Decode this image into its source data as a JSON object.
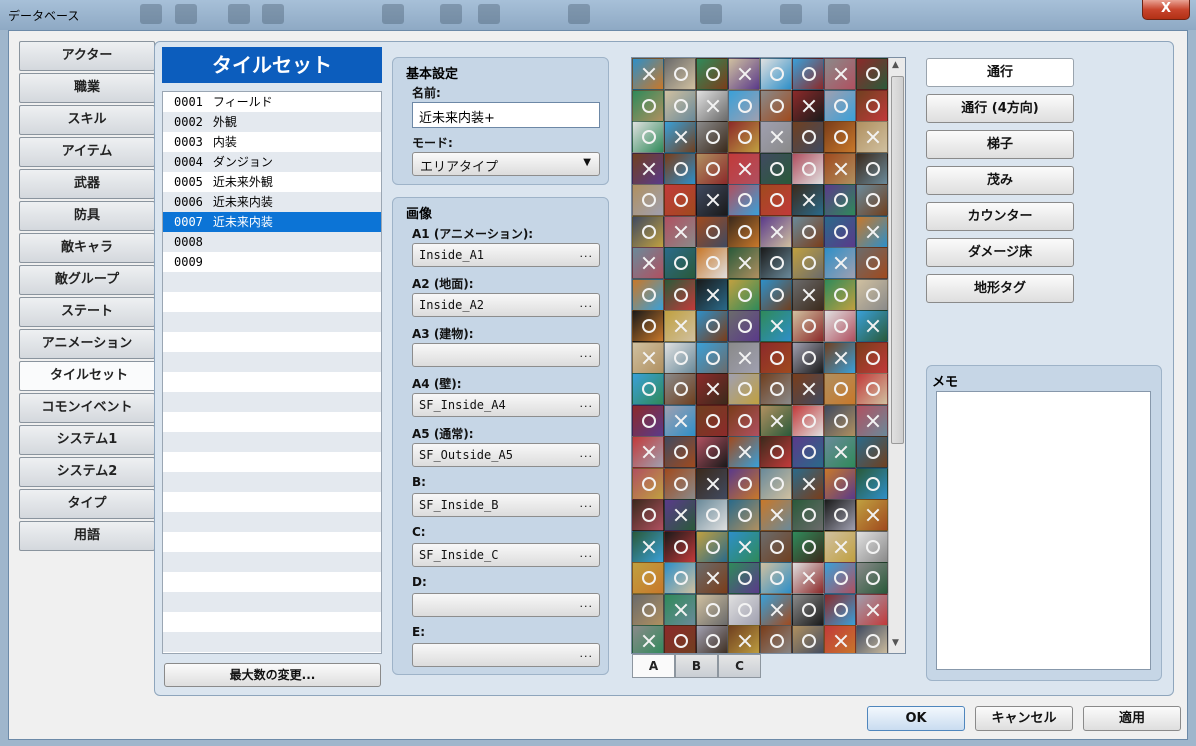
{
  "window": {
    "title": "データベース",
    "close_label": "X"
  },
  "nav": {
    "items": [
      {
        "label": "アクター"
      },
      {
        "label": "職業"
      },
      {
        "label": "スキル"
      },
      {
        "label": "アイテム"
      },
      {
        "label": "武器"
      },
      {
        "label": "防具"
      },
      {
        "label": "敵キャラ"
      },
      {
        "label": "敵グループ"
      },
      {
        "label": "ステート"
      },
      {
        "label": "アニメーション"
      },
      {
        "label": "タイルセット"
      },
      {
        "label": "コモンイベント"
      },
      {
        "label": "システム1"
      },
      {
        "label": "システム2"
      },
      {
        "label": "タイプ"
      },
      {
        "label": "用語"
      }
    ],
    "active_index": 10
  },
  "tileset_list": {
    "header": "タイルセット",
    "rows": [
      {
        "id": "0001",
        "name": "フィールド"
      },
      {
        "id": "0002",
        "name": "外観"
      },
      {
        "id": "0003",
        "name": "内装"
      },
      {
        "id": "0004",
        "name": "ダンジョン"
      },
      {
        "id": "0005",
        "name": "近未来外観"
      },
      {
        "id": "0006",
        "name": "近未来内装"
      },
      {
        "id": "0007",
        "name": "近未来内装"
      },
      {
        "id": "0008",
        "name": ""
      },
      {
        "id": "0009",
        "name": ""
      }
    ],
    "selected_index": 6,
    "max_button_label": "最大数の変更..."
  },
  "basic_settings": {
    "title": "基本設定",
    "name_label": "名前:",
    "name_value": "近未来内装+",
    "mode_label": "モード:",
    "mode_value": "エリアタイプ"
  },
  "images": {
    "title": "画像",
    "slots": [
      {
        "label": "A1 (アニメーション):",
        "value": "Inside_A1"
      },
      {
        "label": "A2 (地面):",
        "value": "Inside_A2"
      },
      {
        "label": "A3 (建物):",
        "value": ""
      },
      {
        "label": "A4 (壁):",
        "value": "SF_Inside_A4"
      },
      {
        "label": "A5 (通常):",
        "value": "SF_Outside_A5"
      },
      {
        "label": "B:",
        "value": "SF_Inside_B"
      },
      {
        "label": "C:",
        "value": "SF_Inside_C"
      },
      {
        "label": "D:",
        "value": ""
      },
      {
        "label": "E:",
        "value": ""
      }
    ],
    "picker_button": "..."
  },
  "tile_tabs": [
    {
      "label": "A"
    },
    {
      "label": "B"
    },
    {
      "label": "C"
    }
  ],
  "tile_tabs_active_index": 0,
  "flag_buttons": [
    {
      "label": "通行"
    },
    {
      "label": "通行 (4方向)"
    },
    {
      "label": "梯子"
    },
    {
      "label": "茂み"
    },
    {
      "label": "カウンター"
    },
    {
      "label": "ダメージ床"
    },
    {
      "label": "地形タグ"
    }
  ],
  "memo": {
    "label": "メモ",
    "value": ""
  },
  "dialog_buttons": {
    "ok": "OK",
    "cancel": "キャンセル",
    "apply": "適用"
  },
  "colors": {
    "accent": "#0c5dbd",
    "selection": "#0c74d6",
    "panel": "#c6d6e6"
  },
  "icons": {
    "scroll_up": "▲",
    "scroll_down": "▼",
    "dropdown": "▼"
  }
}
